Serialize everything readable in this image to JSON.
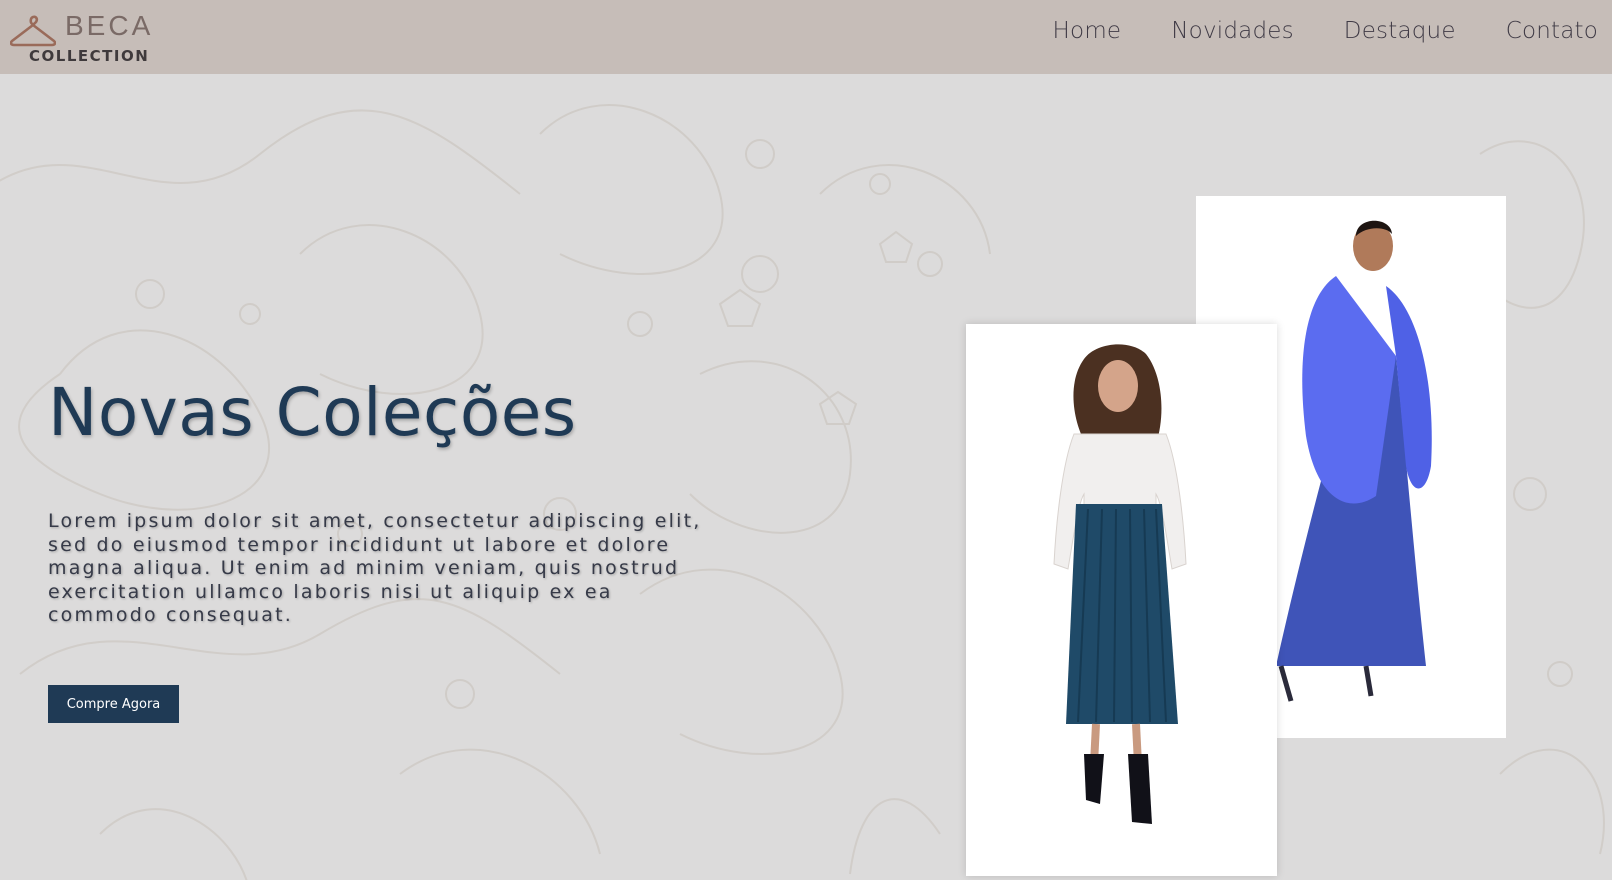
{
  "brand": {
    "top": "BECA",
    "bottom": "COLLECTION"
  },
  "nav": {
    "items": [
      "Home",
      "Novidades",
      "Destaque",
      "Contato"
    ]
  },
  "hero": {
    "title": "Novas Coleções",
    "lead": "Lorem ipsum dolor sit amet, consectetur adipiscing elit, sed do eiusmod tempor incididunt ut labore et dolore magna aliqua. Ut enim ad minim veniam, quis nostrud exercitation ullamco laboris nisi ut aliquip ex ea commodo consequat.",
    "cta_label": "Compre Agora"
  },
  "colors": {
    "header_bg": "#c6bdb8",
    "accent": "#1f3a55",
    "hanger": "#9a6b5a"
  }
}
